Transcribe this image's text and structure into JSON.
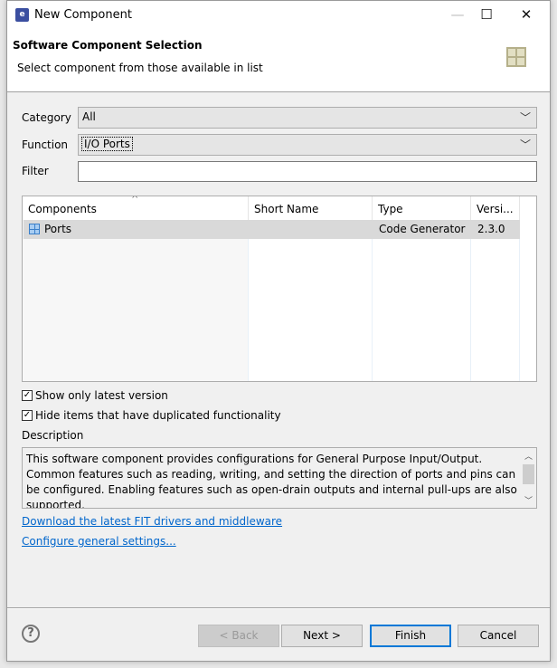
{
  "window": {
    "title": "New Component",
    "app_icon": "e2-studio-icon"
  },
  "header": {
    "title": "Software Component Selection",
    "subtitle": "Select component from those available in list",
    "icon": "component-grid-icon"
  },
  "form": {
    "category_label": "Category",
    "category_value": "All",
    "function_label": "Function",
    "function_value": "I/O Ports",
    "filter_label": "Filter",
    "filter_value": ""
  },
  "table": {
    "columns": [
      "Components",
      "Short Name",
      "Type",
      "Versi..."
    ],
    "rows": [
      {
        "component": "Ports",
        "short_name": "",
        "type": "Code Generator",
        "version": "2.3.0"
      }
    ]
  },
  "options": {
    "show_latest_label": "Show only latest version",
    "show_latest_checked": true,
    "hide_duplicates_label": "Hide items that have duplicated functionality",
    "hide_duplicates_checked": true
  },
  "description": {
    "label": "Description",
    "text": "This software component provides configurations for General Purpose Input/Output. Common features such as reading, writing, and setting the direction of ports and pins can be configured. Enabling features such as open-drain outputs and internal pull-ups are also supported."
  },
  "links": {
    "download": "Download the latest FIT drivers and middleware",
    "configure": "Configure general settings..."
  },
  "buttons": {
    "back": "< Back",
    "next": "Next >",
    "finish": "Finish",
    "cancel": "Cancel",
    "help": "?"
  }
}
